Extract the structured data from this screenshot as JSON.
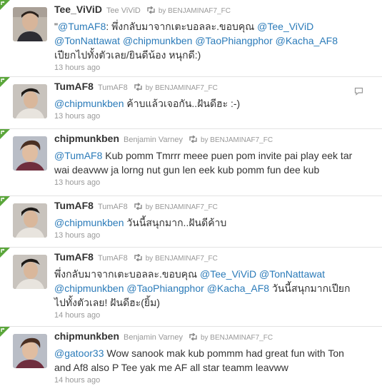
{
  "retweeted_by": "by BENJAMINAF7_FC",
  "colors": {
    "link": "#2b7bb9",
    "muted": "#999999",
    "retweet_corner": "#5aa63a"
  },
  "tweets": [
    {
      "name": "Tee_ViViD",
      "handle": "Tee ViViD",
      "avatar": "avatar-tee",
      "segments": [
        {
          "t": "\""
        },
        {
          "m": "@TumAF8"
        },
        {
          "t": ": พึ่งกลับมาจากเตะบอลละ.ขอบคุณ "
        },
        {
          "m": "@Tee_ViViD"
        },
        {
          "t": " "
        },
        {
          "m": "@TonNattawat"
        },
        {
          "t": " "
        },
        {
          "m": "@chipmunkben"
        },
        {
          "t": " "
        },
        {
          "m": "@TaoPhiangphor"
        },
        {
          "t": " "
        },
        {
          "m": "@Kacha_AF8"
        },
        {
          "t": " เปียกไปทั้งตัวเลย/ยินดีน้อง หนุกดี:)"
        }
      ],
      "time": "13 hours ago",
      "reply": false
    },
    {
      "name": "TumAF8",
      "handle": "TumAF8",
      "avatar": "avatar-tum",
      "segments": [
        {
          "m": "@chipmunkben"
        },
        {
          "t": " ค้าบแล้วเจอกัน..ฝันดีฮะ :-)"
        }
      ],
      "time": "13 hours ago",
      "reply": true
    },
    {
      "name": "chipmunkben",
      "handle": "Benjamin Varney",
      "avatar": "avatar-ben",
      "segments": [
        {
          "m": "@TumAF8"
        },
        {
          "t": " Kub pomm Tmrrr meee puen pom invite pai play eek tar wai deavww ja lorng nut gun len eek kub pomm fun dee kub"
        }
      ],
      "time": "13 hours ago",
      "reply": false
    },
    {
      "name": "TumAF8",
      "handle": "TumAF8",
      "avatar": "avatar-tum",
      "segments": [
        {
          "m": "@chipmunkben"
        },
        {
          "t": " วันนี้สนุกมาก..ฝันดีค้าบ"
        }
      ],
      "time": "13 hours ago",
      "reply": false
    },
    {
      "name": "TumAF8",
      "handle": "TumAF8",
      "avatar": "avatar-tum",
      "segments": [
        {
          "t": "พึ่งกลับมาจากเตะบอลละ.ขอบคุณ "
        },
        {
          "m": "@Tee_ViViD"
        },
        {
          "t": " "
        },
        {
          "m": "@TonNattawat"
        },
        {
          "t": " "
        },
        {
          "m": "@chipmunkben"
        },
        {
          "t": " "
        },
        {
          "m": "@TaoPhiangphor"
        },
        {
          "t": " "
        },
        {
          "m": "@Kacha_AF8"
        },
        {
          "t": " วันนี้สนุกมากเปียกไปทั้งตัวเลย! ฝันดีฮะ(ยิ้ม)"
        }
      ],
      "time": "14 hours ago",
      "reply": false
    },
    {
      "name": "chipmunkben",
      "handle": "Benjamin Varney",
      "avatar": "avatar-ben",
      "segments": [
        {
          "m": "@gatoor33"
        },
        {
          "t": " Wow sanook mak kub pommm had great fun with Ton and Af8 also P Tee yak me AF all star teamm leavww"
        }
      ],
      "time": "14 hours ago",
      "reply": false
    }
  ]
}
